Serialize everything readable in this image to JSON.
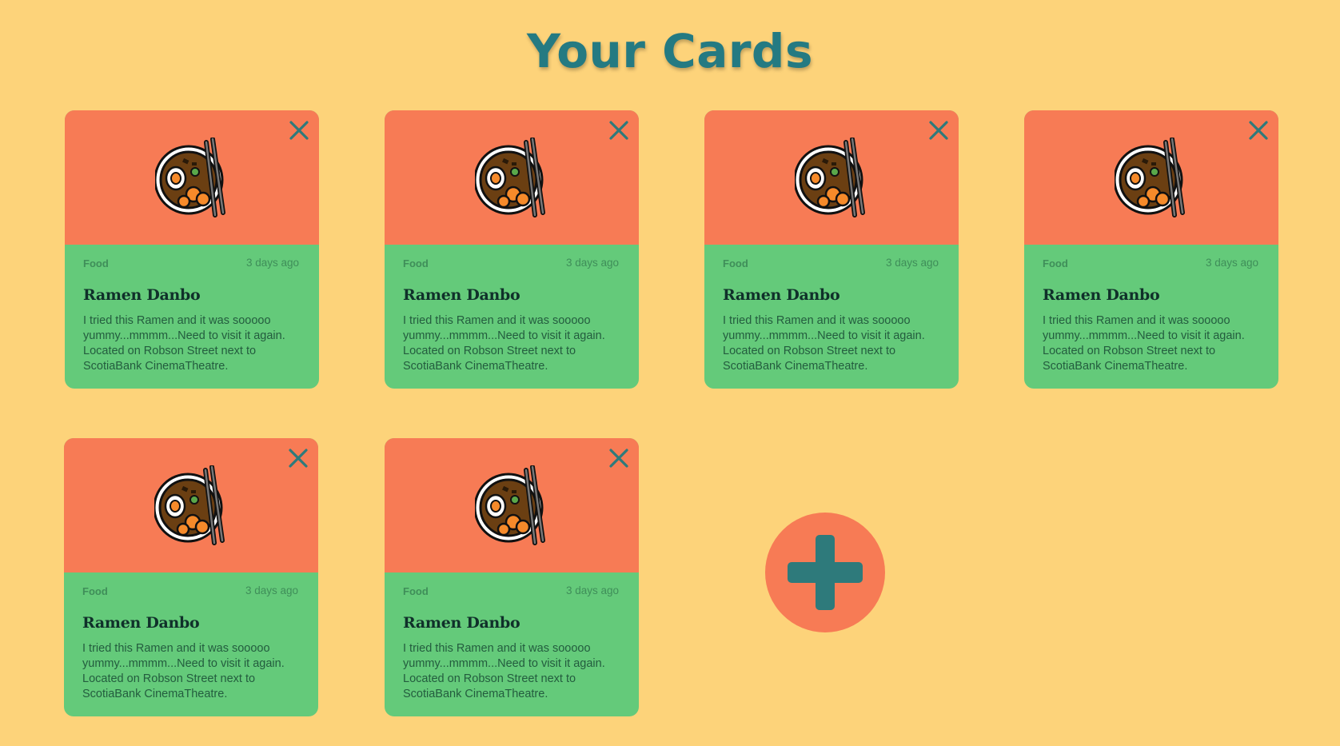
{
  "page": {
    "title": "Your Cards"
  },
  "colors": {
    "background": "#fdd37a",
    "title": "#247a82",
    "card_top": "#f77b55",
    "card_bottom": "#64ca7a",
    "icon_accent": "#2e7a7b"
  },
  "cards": [
    {
      "category": "Food",
      "time": "3 days ago",
      "title": "Ramen Danbo",
      "description": "I tried this Ramen and it was sooooo yummy...mmmm...Need to visit it again. Located on Robson Street next to ScotiaBank CinemaTheatre.",
      "image_icon": "ramen-bowl-icon",
      "close_icon": "close-icon"
    },
    {
      "category": "Food",
      "time": "3 days ago",
      "title": "Ramen Danbo",
      "description": "I tried this Ramen and it was sooooo yummy...mmmm...Need to visit it again. Located on Robson Street next to ScotiaBank CinemaTheatre.",
      "image_icon": "ramen-bowl-icon",
      "close_icon": "close-icon"
    },
    {
      "category": "Food",
      "time": "3 days ago",
      "title": "Ramen Danbo",
      "description": "I tried this Ramen and it was sooooo yummy...mmmm...Need to visit it again. Located on Robson Street next to ScotiaBank CinemaTheatre.",
      "image_icon": "ramen-bowl-icon",
      "close_icon": "close-icon"
    },
    {
      "category": "Food",
      "time": "3 days ago",
      "title": "Ramen Danbo",
      "description": "I tried this Ramen and it was sooooo yummy...mmmm...Need to visit it again. Located on Robson Street next to ScotiaBank CinemaTheatre.",
      "image_icon": "ramen-bowl-icon",
      "close_icon": "close-icon"
    },
    {
      "category": "Food",
      "time": "3 days ago",
      "title": "Ramen Danbo",
      "description": "I tried this Ramen and it was sooooo yummy...mmmm...Need to visit it again. Located on Robson Street next to ScotiaBank CinemaTheatre.",
      "image_icon": "ramen-bowl-icon",
      "close_icon": "close-icon"
    },
    {
      "category": "Food",
      "time": "3 days ago",
      "title": "Ramen Danbo",
      "description": "I tried this Ramen and it was sooooo yummy...mmmm...Need to visit it again. Located on Robson Street next to ScotiaBank CinemaTheatre.",
      "image_icon": "ramen-bowl-icon",
      "close_icon": "close-icon"
    }
  ],
  "add_button": {
    "icon": "plus-icon"
  }
}
